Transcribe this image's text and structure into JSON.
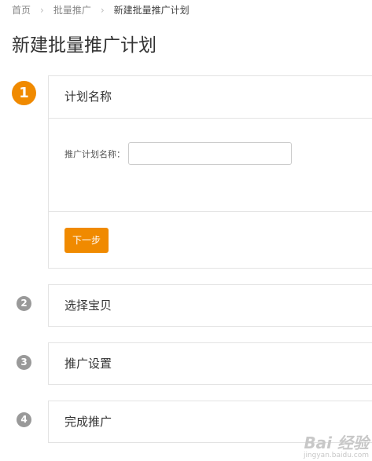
{
  "breadcrumb": {
    "home": "首页",
    "batch": "批量推广",
    "current": "新建批量推广计划",
    "separator": "›"
  },
  "page": {
    "title": "新建批量推广计划"
  },
  "steps": [
    {
      "number": "1",
      "title": "计划名称",
      "state": "active"
    },
    {
      "number": "2",
      "title": "选择宝贝",
      "state": "inactive"
    },
    {
      "number": "3",
      "title": "推广设置",
      "state": "inactive"
    },
    {
      "number": "4",
      "title": "完成推广",
      "state": "inactive"
    }
  ],
  "form": {
    "plan_name_label": "推广计划名称：",
    "plan_name_value": "",
    "next_label": "下一步"
  },
  "watermark": {
    "main": "Bai 经验",
    "sub": "jingyan.baidu.com"
  },
  "colors": {
    "accent": "#f08a00",
    "inactive_step": "#999999",
    "border": "#e3e3e3"
  }
}
